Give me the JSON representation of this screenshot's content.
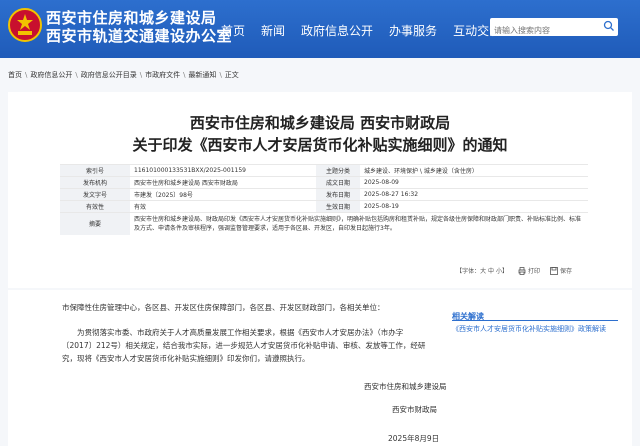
{
  "site": {
    "title_line1": "西安市住房和城乡建设局",
    "title_line2": "西安市轨道交通建设办公室"
  },
  "nav": [
    "首页",
    "新闻",
    "政府信息公开",
    "办事服务",
    "互动交流"
  ],
  "search": {
    "placeholder": "请输入搜索内容"
  },
  "breadcrumb": [
    "首页",
    "政府信息公开",
    "政府信息公开目录",
    "市政府文件",
    "最新通知",
    "正文"
  ],
  "article": {
    "title_line1": "西安市住房和城乡建设局 西安市财政局",
    "title_line2": "关于印发《西安市人才安居货币化补贴实施细则》的通知",
    "meta": {
      "index_label": "索引号",
      "index_value": "116101000133531BXX/2025-001159",
      "topic_label": "主题分类",
      "topic_value": "城乡建设、环境保护 \\ 城乡建设（含住房）",
      "issuer_label": "发布机构",
      "issuer_value": "西安市住房和城乡建设局 西安市财政局",
      "created_label": "成文日期",
      "created_value": "2025-08-09",
      "docno_label": "发文字号",
      "docno_value": "市建发〔2025〕98号",
      "pubdate_label": "发布日期",
      "pubdate_value": "2025-08-27 16:32",
      "validity_label": "有效性",
      "validity_value": "有效",
      "effective_label": "生效日期",
      "effective_value": "2025-08-19",
      "summary_label": "摘要",
      "summary_text": "西安市住房和城乡建设局、财政局印发《西安市人才安居货币化补贴实施细则》，明确补贴包括购房和租赁补贴，规定各级住房保障和财政部门职责、补贴标准比例、标准及方式、申请条件及审核程序，强调监督管理要求，适用于各区县、开发区，自印发日起施行3年。"
    },
    "tools": {
      "font": "【字体：大 中 小】",
      "print": "打印",
      "save": "保存"
    },
    "salutation": "市保障性住房管理中心，各区县、开发区住房保障部门，各区县、开发区财政部门，各相关单位：",
    "body": "为贯彻落实市委、市政府关于人才高质量发展工作相关要求，根据《西安市人才安居办法》（市办字〔2017〕212号）相关规定，结合我市实际，进一步规范人才安居货币化补贴申请、审核、发放等工作，经研究，现将《西安市人才安居货币化补贴实施细则》印发你们，请遵照执行。",
    "signature1": "西安市住房和城乡建设局",
    "signature2": "西安市财政局",
    "date": "2025年8月9日"
  },
  "sidebar": {
    "heading": "相关解读",
    "link": "《西安市人才安居货币化补贴实施细则》政策解读"
  },
  "colors": {
    "header": "#1f5bb9",
    "accent": "#2d6fce"
  }
}
